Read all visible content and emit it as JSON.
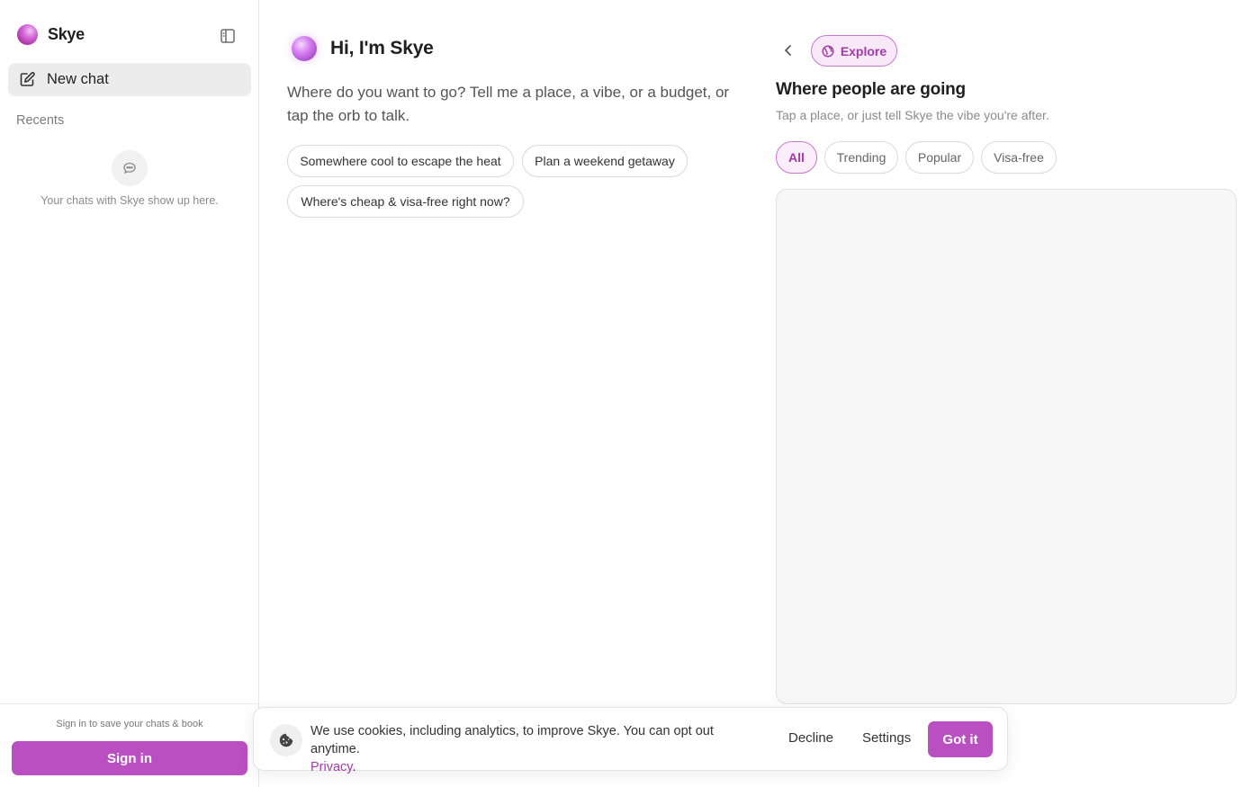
{
  "sidebar": {
    "brand": "Skye",
    "new_chat_label": "New chat",
    "recents_label": "Recents",
    "empty_state": "Your chats with Skye show up here.",
    "signin_hint": "Sign in to save your chats & book",
    "signin_label": "Sign in"
  },
  "chat": {
    "greeting": "Hi, I'm Skye",
    "intro": "Where do you want to go? Tell me a place, a vibe, or a budget, or tap the orb to talk.",
    "suggestions": [
      "Somewhere cool to escape the heat",
      "Plan a weekend getaway",
      "Where's cheap & visa-free right now?"
    ]
  },
  "explore": {
    "pill_label": "Explore",
    "title": "Where people are going",
    "subtitle": "Tap a place, or just tell Skye the vibe you're after.",
    "filters": [
      "All",
      "Trending",
      "Popular",
      "Visa-free"
    ],
    "active_filter": "All"
  },
  "cookie": {
    "text": "We use cookies, including analytics, to improve Skye. You can opt out anytime.",
    "link": "Privacy",
    "link_suffix": ".",
    "decline": "Decline",
    "settings": "Settings",
    "accept": "Got it"
  },
  "colors": {
    "accent": "#b94fc0",
    "accent_text": "#a33aa9",
    "accent_bg": "#f8e8f8"
  },
  "icons": {
    "brand": "orb-logo-icon",
    "collapse": "sidebar-collapse-icon",
    "new_chat": "edit-icon",
    "empty": "chat-bubble-icon",
    "back": "chevron-left-icon",
    "explore": "globe-icon",
    "cookie": "cookie-icon"
  }
}
